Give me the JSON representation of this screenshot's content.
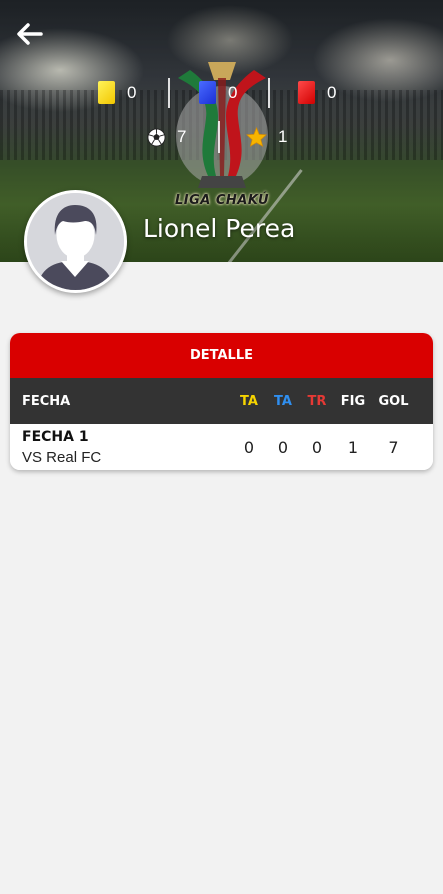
{
  "header": {
    "back_icon": "arrow-left-icon",
    "logo_text": "LIGA CHAKÚ",
    "stats": {
      "yellow_cards": "0",
      "blue_cards": "0",
      "red_cards": "0",
      "goals": "7",
      "mvp": "1"
    },
    "colors": {
      "yellow_card": "#f2c600",
      "blue_card": "#1a2fd6",
      "red_card": "#d10000"
    }
  },
  "player": {
    "name": "Lionel Perea"
  },
  "detail": {
    "title": "DETALLE",
    "columns": {
      "fecha": "FECHA",
      "ta_yellow": "TA",
      "ta_blue": "TA",
      "tr": "TR",
      "fig": "FIG",
      "gol": "GOL"
    },
    "rows": [
      {
        "fecha": "FECHA 1",
        "opponent": "VS Real FC",
        "ta_yellow": "0",
        "ta_blue": "0",
        "tr": "0",
        "fig": "1",
        "gol": "7"
      }
    ],
    "accent_color": "#d90000",
    "header_color": "#333333"
  }
}
